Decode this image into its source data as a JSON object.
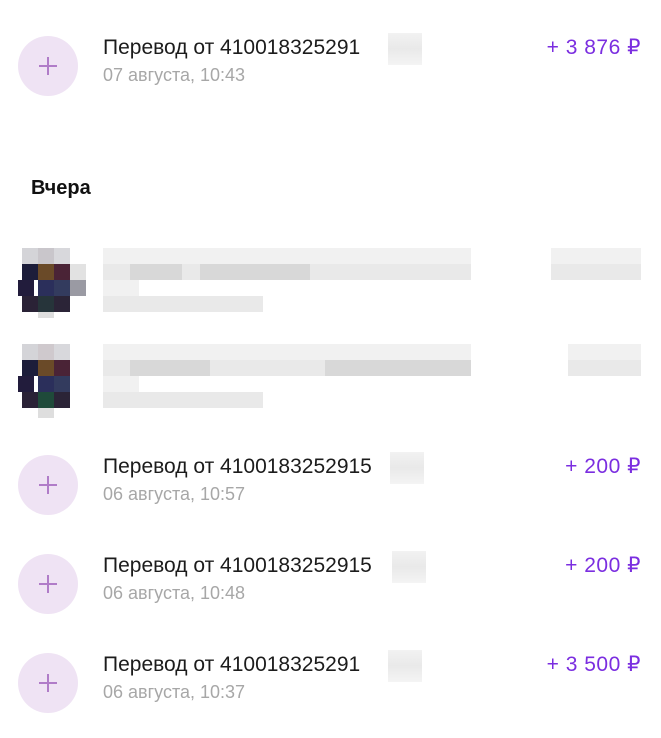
{
  "colors": {
    "amount": "#7b2ee0",
    "icon_bg": "#efe3f4",
    "plus": "#b07cc8",
    "date": "#a7a7a7"
  },
  "feed": {
    "top_transaction": {
      "title": "Перевод от 410018325291",
      "date": "07 августа, 10:43",
      "amount": "+ 3 876 ₽",
      "icon": "plus-icon"
    },
    "section_title": "Вчера",
    "yesterday_transactions": [
      {
        "title": "Перевод от 4100183252915",
        "date": "06 августа, 10:57",
        "amount": "+ 200 ₽",
        "icon": "plus-icon"
      },
      {
        "title": "Перевод от 4100183252915",
        "date": "06 августа, 10:48",
        "amount": "+ 200 ₽",
        "icon": "plus-icon"
      },
      {
        "title": "Перевод от 410018325291",
        "date": "06 августа, 10:37",
        "amount": "+ 3 500 ₽",
        "icon": "plus-icon"
      }
    ]
  }
}
